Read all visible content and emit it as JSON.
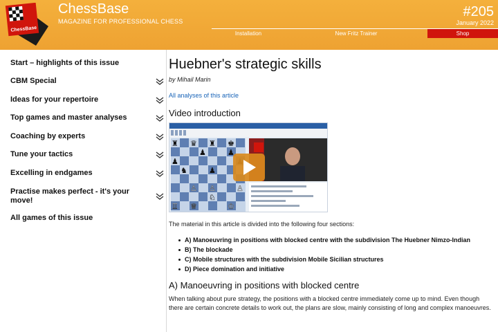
{
  "header": {
    "brand": "ChessBase",
    "tagline": "MAGAZINE FOR PROFESSIONAL CHESS",
    "issue_number": "#205",
    "issue_date": "January 2022",
    "logo_text": "ChessBase",
    "nav": [
      {
        "label": "Installation"
      },
      {
        "label": "New Fritz Trainer"
      },
      {
        "label": "Shop"
      }
    ],
    "colors": {
      "bar": "#eea232",
      "shop": "#d0150c"
    }
  },
  "sidebar": {
    "items": [
      {
        "label": "Start – highlights of this issue",
        "has_chevron": false
      },
      {
        "label": "CBM Special",
        "has_chevron": true
      },
      {
        "label": "Ideas for your repertoire",
        "has_chevron": true
      },
      {
        "label": "Top games and master analyses",
        "has_chevron": true
      },
      {
        "label": "Coaching by experts",
        "has_chevron": true
      },
      {
        "label": "Tune your tactics",
        "has_chevron": true
      },
      {
        "label": "Excelling in endgames",
        "has_chevron": true
      },
      {
        "label": "Practise makes perfect - it's your move!",
        "has_chevron": true
      },
      {
        "label": "All games of this issue",
        "has_chevron": false
      }
    ],
    "chevron_icon": "double-chevron-down-icon"
  },
  "article": {
    "title": "Huebner's strategic skills",
    "author": "by Mihail Marin",
    "analyses_link": "All analyses of this article",
    "video_heading": "Video introduction",
    "video_play_icon": "play-icon",
    "intro": "The material in this article is divided into the following four sections:",
    "sections": [
      "A) Manoeuvring in positions with blocked centre with the subdivision The Huebner Nimzo-Indian",
      "B) The blockade",
      "C) Mobile structures with the subdivision Mobile Sicilian structures",
      "D) Piece domination and initiative"
    ],
    "section_a_heading": "A) Manoeuvring in positions with blocked centre",
    "section_a_text": "When talking about pure strategy, the positions with a blocked centre immediately come up to mind. Even though there are certain concrete details to work out, the plans are slow, mainly consisting of long and complex manoeuvres."
  }
}
